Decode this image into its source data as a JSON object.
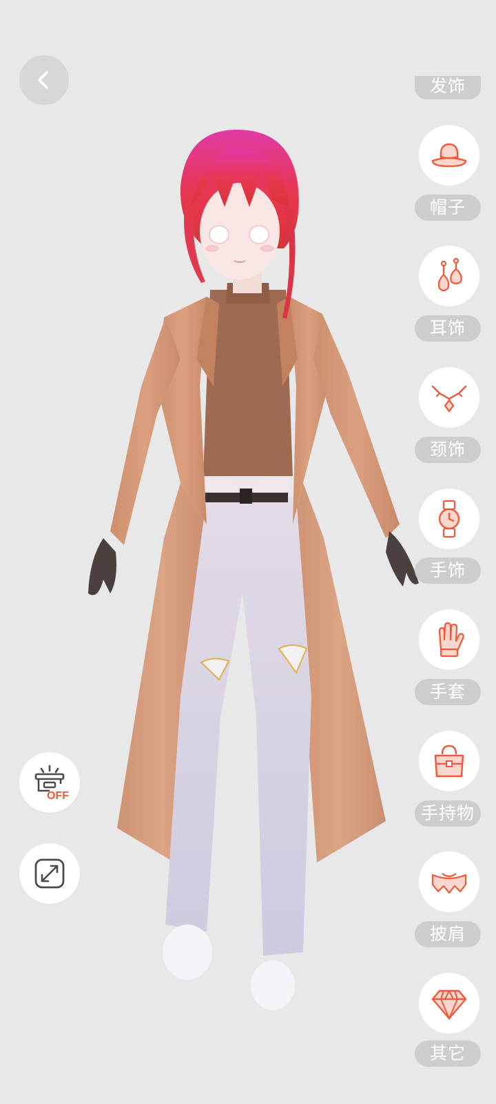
{
  "top_partial_category": {
    "label": "发饰"
  },
  "categories": [
    {
      "label": "帽子",
      "icon": "hat-icon"
    },
    {
      "label": "耳饰",
      "icon": "earrings-icon"
    },
    {
      "label": "颈饰",
      "icon": "necklace-icon"
    },
    {
      "label": "手饰",
      "icon": "wristwatch-icon"
    },
    {
      "label": "手套",
      "icon": "glove-icon"
    },
    {
      "label": "手持物",
      "icon": "handbag-icon"
    },
    {
      "label": "披肩",
      "icon": "shawl-icon"
    },
    {
      "label": "其它",
      "icon": "diamond-icon"
    }
  ],
  "tools": {
    "effects_toggle": {
      "icon": "effects-off-icon",
      "state_text": "OFF"
    },
    "fullscreen": {
      "icon": "expand-icon"
    }
  },
  "back": {
    "icon": "chevron-left-icon"
  },
  "colors": {
    "accent": "#f0573b",
    "background": "#e9e8e8",
    "chip": "#c8c8c8"
  }
}
